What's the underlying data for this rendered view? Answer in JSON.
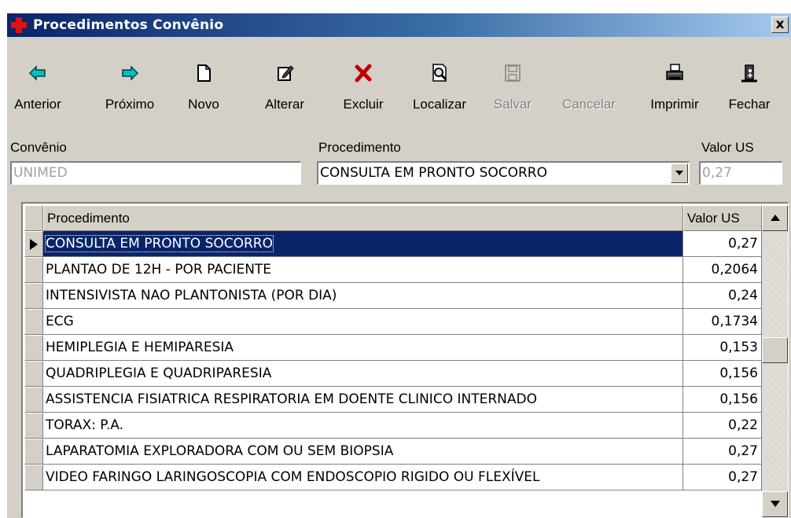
{
  "window": {
    "title": "Procedimentos Convênio",
    "close_label": "x"
  },
  "toolbar": [
    {
      "id": "anterior",
      "label": "Anterior",
      "icon": "arrow-left-icon",
      "enabled": true
    },
    {
      "id": "proximo",
      "label": "Próximo",
      "icon": "arrow-right-icon",
      "enabled": true
    },
    {
      "id": "novo",
      "label": "Novo",
      "icon": "new-document-icon",
      "enabled": true
    },
    {
      "id": "alterar",
      "label": "Alterar",
      "icon": "edit-icon",
      "enabled": true
    },
    {
      "id": "excluir",
      "label": "Excluir",
      "icon": "delete-x-icon",
      "enabled": true
    },
    {
      "id": "localizar",
      "label": "Localizar",
      "icon": "search-document-icon",
      "enabled": true
    },
    {
      "id": "salvar",
      "label": "Salvar",
      "icon": "save-disk-icon",
      "enabled": false
    },
    {
      "id": "cancelar",
      "label": "Cancelar",
      "icon": "cancel-icon",
      "enabled": false
    },
    {
      "id": "imprimir",
      "label": "Imprimir",
      "icon": "printer-icon",
      "enabled": true
    },
    {
      "id": "fechar",
      "label": "Fechar",
      "icon": "exit-door-icon",
      "enabled": true
    }
  ],
  "form": {
    "convenio_label": "Convênio",
    "convenio_value": "UNIMED",
    "procedimento_label": "Procedimento",
    "procedimento_value": "CONSULTA EM PRONTO SOCORRO",
    "valor_label": "Valor US",
    "valor_value": "0,27"
  },
  "grid": {
    "headers": [
      "Procedimento",
      "Valor US"
    ],
    "selected_row": 0,
    "rows": [
      {
        "proc": "CONSULTA EM PRONTO SOCORRO",
        "val": "0,27"
      },
      {
        "proc": "PLANTAO DE 12H - POR PACIENTE",
        "val": "0,2064"
      },
      {
        "proc": "INTENSIVISTA NAO PLANTONISTA (POR DIA)",
        "val": "0,24"
      },
      {
        "proc": "ECG",
        "val": "0,1734"
      },
      {
        "proc": "HEMIPLEGIA E HEMIPARESIA",
        "val": "0,153"
      },
      {
        "proc": "QUADRIPLEGIA E QUADRIPARESIA",
        "val": "0,156"
      },
      {
        "proc": "ASSISTENCIA FISIATRICA RESPIRATORIA EM DOENTE CLINICO INTERNADO",
        "val": "0,156"
      },
      {
        "proc": "TORAX: P.A.",
        "val": "0,22"
      },
      {
        "proc": "LAPARATOMIA EXPLORADORA COM OU SEM BIOPSIA",
        "val": "0,27"
      },
      {
        "proc": "VIDEO FARINGO LARINGOSCOPIA COM ENDOSCOPIO RIGIDO OU FLEXÍVEL",
        "val": "0,27"
      }
    ]
  },
  "colors": {
    "titlebar_start": "#0a246a",
    "titlebar_end": "#a6caf0",
    "selection": "#0a246a",
    "face": "#d4d0c8"
  }
}
